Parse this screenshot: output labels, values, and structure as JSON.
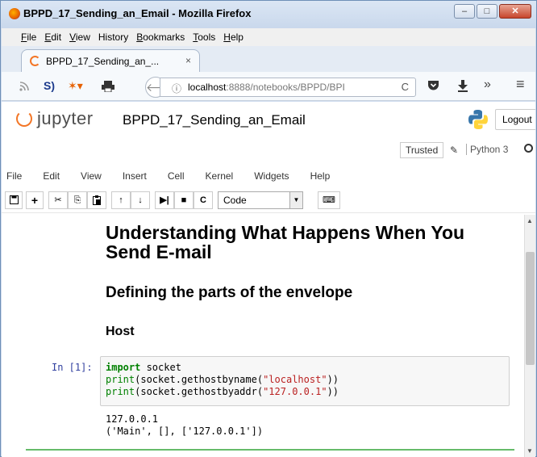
{
  "window": {
    "title": "BPPD_17_Sending_an_Email - Mozilla Firefox",
    "min_glyph": "–",
    "max_glyph": "□",
    "close_glyph": "✕"
  },
  "menubar": {
    "items": [
      {
        "u": "F",
        "rest": "ile"
      },
      {
        "u": "E",
        "rest": "dit"
      },
      {
        "u": "V",
        "rest": "iew"
      },
      {
        "u": "",
        "rest": "History"
      },
      {
        "u": "B",
        "rest": "ookmarks"
      },
      {
        "u": "T",
        "rest": "ools"
      },
      {
        "u": "H",
        "rest": "elp"
      }
    ]
  },
  "tab": {
    "title": "BPPD_17_Sending_an_...",
    "close": "×"
  },
  "navbar": {
    "url_host": "localhost",
    "url_rest": ":8888/notebooks/BPPD/BPI",
    "info_icon": "ⓘ",
    "reload_icon": "C",
    "icons": {
      "rss": "rss-icon",
      "skype": "s-icon",
      "addon": "addon-icon",
      "print": "print-icon",
      "pocket": "pocket-icon",
      "download": "download-icon",
      "more": "»",
      "menu": "≡"
    }
  },
  "jupyter": {
    "logo_text": "jupyter",
    "notebook_name": "BPPD_17_Sending_an_Email",
    "logout": "Logout",
    "trusted": "Trusted",
    "kernel": "Python 3",
    "menu": [
      "File",
      "Edit",
      "View",
      "Insert",
      "Cell",
      "Kernel",
      "Widgets",
      "Help"
    ],
    "toolbar": {
      "save": "💾",
      "add": "+",
      "cut": "✂",
      "copy": "⎘",
      "paste": "📋",
      "up": "↑",
      "down": "↓",
      "run": "⏭",
      "stop": "■",
      "restart": "C",
      "cell_type": "Code",
      "keyboard": "⌨"
    }
  },
  "notebook": {
    "h1": "Understanding What Happens When You Send E-mail",
    "h2": "Defining the parts of the envelope",
    "h3": "Host",
    "prompt": "In [1]:",
    "code": {
      "line1_kw": "import",
      "line1_rest": " socket",
      "line2_fn": "print",
      "line2_a": "(socket.gethostbyname(",
      "line2_str": "\"localhost\"",
      "line2_b": "))",
      "line3_fn": "print",
      "line3_a": "(socket.gethostbyaddr(",
      "line3_str": "\"127.0.0.1\"",
      "line3_b": "))"
    },
    "output": [
      "127.0.0.1",
      "('Main', [], ['127.0.0.1'])"
    ]
  },
  "colors": {
    "accent_orange": "#f37626",
    "code_keyword": "#008000",
    "code_string": "#ba2121",
    "prompt_blue": "#303f9f"
  }
}
